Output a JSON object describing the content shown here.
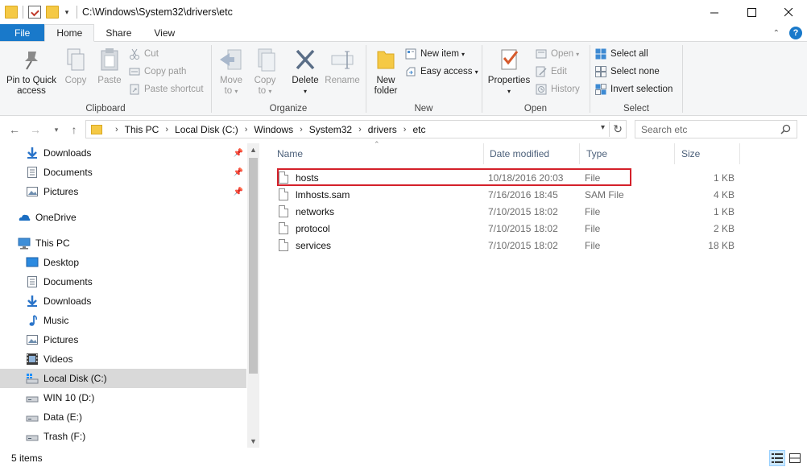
{
  "window": {
    "title": "C:\\Windows\\System32\\drivers\\etc",
    "minimize_icon": "minimize-icon",
    "maximize_icon": "maximize-icon",
    "close_icon": "close-icon"
  },
  "ribbon_tabs": [
    {
      "label": "File"
    },
    {
      "label": "Home"
    },
    {
      "label": "Share"
    },
    {
      "label": "View"
    }
  ],
  "ribbon": {
    "clipboard": {
      "label": "Clipboard",
      "pin_label_1": "Pin to Quick",
      "pin_label_2": "access",
      "copy": "Copy",
      "paste": "Paste",
      "cut": "Cut",
      "copy_path": "Copy path",
      "paste_shortcut": "Paste shortcut"
    },
    "organize": {
      "label": "Organize",
      "move_to_1": "Move",
      "move_to_2": "to",
      "copy_to_1": "Copy",
      "copy_to_2": "to",
      "delete": "Delete",
      "rename": "Rename"
    },
    "new": {
      "label": "New",
      "new_folder_1": "New",
      "new_folder_2": "folder",
      "new_item": "New item",
      "easy_access": "Easy access"
    },
    "open": {
      "label": "Open",
      "properties": "Properties",
      "open": "Open",
      "edit": "Edit",
      "history": "History"
    },
    "select": {
      "label": "Select",
      "select_all": "Select all",
      "select_none": "Select none",
      "invert_selection": "Invert selection"
    }
  },
  "address": {
    "crumbs": [
      "This PC",
      "Local Disk (C:)",
      "Windows",
      "System32",
      "drivers",
      "etc"
    ],
    "search_placeholder": "Search etc"
  },
  "nav": {
    "items": [
      {
        "label": "Downloads",
        "icon": "download-arrow-icon",
        "pinned": true
      },
      {
        "label": "Documents",
        "icon": "documents-icon",
        "pinned": true
      },
      {
        "label": "Pictures",
        "icon": "pictures-icon",
        "pinned": true
      },
      {
        "label": "OneDrive",
        "icon": "onedrive-cloud-icon"
      },
      {
        "label": "This PC",
        "icon": "computer-icon"
      },
      {
        "label": "Desktop",
        "icon": "desktop-icon"
      },
      {
        "label": "Documents",
        "icon": "documents-icon"
      },
      {
        "label": "Downloads",
        "icon": "download-arrow-icon"
      },
      {
        "label": "Music",
        "icon": "music-note-icon"
      },
      {
        "label": "Pictures",
        "icon": "pictures-icon"
      },
      {
        "label": "Videos",
        "icon": "videos-icon"
      },
      {
        "label": "Local Disk (C:)",
        "icon": "windows-drive-icon",
        "selected": true
      },
      {
        "label": "WIN 10 (D:)",
        "icon": "drive-icon"
      },
      {
        "label": "Data (E:)",
        "icon": "drive-icon"
      },
      {
        "label": "Trash (F:)",
        "icon": "drive-icon"
      }
    ]
  },
  "filelist": {
    "columns": {
      "name": "Name",
      "date": "Date modified",
      "type": "Type",
      "size": "Size"
    },
    "rows": [
      {
        "name": "hosts",
        "date": "10/18/2016 20:03",
        "type": "File",
        "size": "1 KB",
        "highlighted": true
      },
      {
        "name": "lmhosts.sam",
        "date": "7/16/2016 18:45",
        "type": "SAM File",
        "size": "4 KB"
      },
      {
        "name": "networks",
        "date": "7/10/2015 18:02",
        "type": "File",
        "size": "1 KB"
      },
      {
        "name": "protocol",
        "date": "7/10/2015 18:02",
        "type": "File",
        "size": "2 KB"
      },
      {
        "name": "services",
        "date": "7/10/2015 18:02",
        "type": "File",
        "size": "18 KB"
      }
    ]
  },
  "status": {
    "item_count": "5 items"
  },
  "colors": {
    "file_tab_blue": "#1979ca",
    "highlight_red": "#d4202a",
    "selected_nav": "#d9d9d9",
    "folder_yellow": "#f5c945"
  }
}
